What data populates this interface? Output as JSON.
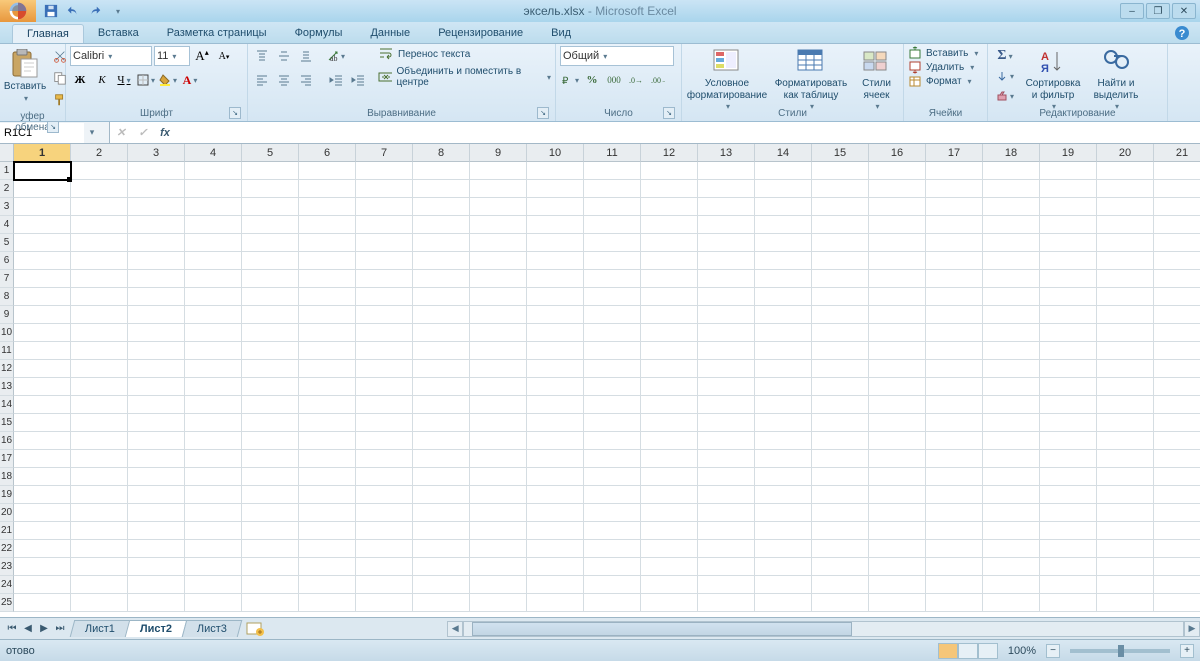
{
  "title": {
    "filename": "эксель.xlsx",
    "app": "Microsoft Excel"
  },
  "tabs": {
    "items": [
      "Главная",
      "Вставка",
      "Разметка страницы",
      "Формулы",
      "Данные",
      "Рецензирование",
      "Вид"
    ],
    "active_index": 0
  },
  "ribbon": {
    "clipboard": {
      "label": "уфер обмена",
      "paste": "Вставить"
    },
    "font": {
      "label": "Шрифт",
      "name": "Calibri",
      "size": "11",
      "bold": "Ж",
      "italic": "К",
      "underline": "Ч"
    },
    "alignment": {
      "label": "Выравнивание",
      "wrap": "Перенос текста",
      "merge": "Объединить и поместить в центре"
    },
    "number": {
      "label": "Число",
      "format": "Общий",
      "percent": "%",
      "comma": "000"
    },
    "styles": {
      "label": "Стили",
      "cond": "Условное форматирование",
      "table": "Форматировать как таблицу",
      "cell": "Стили ячеек"
    },
    "cells": {
      "label": "Ячейки",
      "insert": "Вставить",
      "delete": "Удалить",
      "format": "Формат"
    },
    "editing": {
      "label": "Редактирование",
      "sort": "Сортировка и фильтр",
      "find": "Найти и выделить"
    }
  },
  "formula_bar": {
    "name_box": "R1C1",
    "formula": ""
  },
  "grid": {
    "cols": [
      "1",
      "2",
      "3",
      "4",
      "5",
      "6",
      "7",
      "8",
      "9",
      "10",
      "11",
      "12",
      "13",
      "14",
      "15",
      "16",
      "17",
      "18",
      "19",
      "20",
      "21"
    ],
    "row_count": 25,
    "selected_col_index": 0,
    "selected_row_index": 0
  },
  "sheets": {
    "items": [
      "Лист1",
      "Лист2",
      "Лист3"
    ],
    "active_index": 1
  },
  "status": {
    "ready": "отово",
    "zoom": "100%"
  }
}
